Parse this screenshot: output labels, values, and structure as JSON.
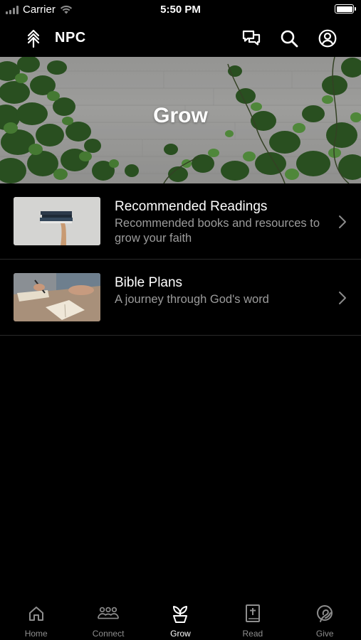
{
  "status_bar": {
    "carrier": "Carrier",
    "time": "5:50 PM"
  },
  "header": {
    "title": "NPC",
    "icons": [
      "logo-icon",
      "messages-icon",
      "search-icon",
      "profile-icon"
    ]
  },
  "hero": {
    "title": "Grow"
  },
  "items": [
    {
      "title": "Recommended Readings",
      "subtitle": "Recommended books and resources to grow your faith"
    },
    {
      "title": "Bible Plans",
      "subtitle": "A journey through God's word"
    }
  ],
  "tabs": [
    {
      "label": "Home",
      "icon": "home-icon",
      "active": false
    },
    {
      "label": "Connect",
      "icon": "people-icon",
      "active": false
    },
    {
      "label": "Grow",
      "icon": "plant-icon",
      "active": true
    },
    {
      "label": "Read",
      "icon": "bible-icon",
      "active": false
    },
    {
      "label": "Give",
      "icon": "give-icon",
      "active": false
    }
  ],
  "colors": {
    "background": "#000000",
    "text": "#ffffff",
    "secondary_text": "#9c9c9c",
    "inactive_tab": "#8e8e8e"
  }
}
